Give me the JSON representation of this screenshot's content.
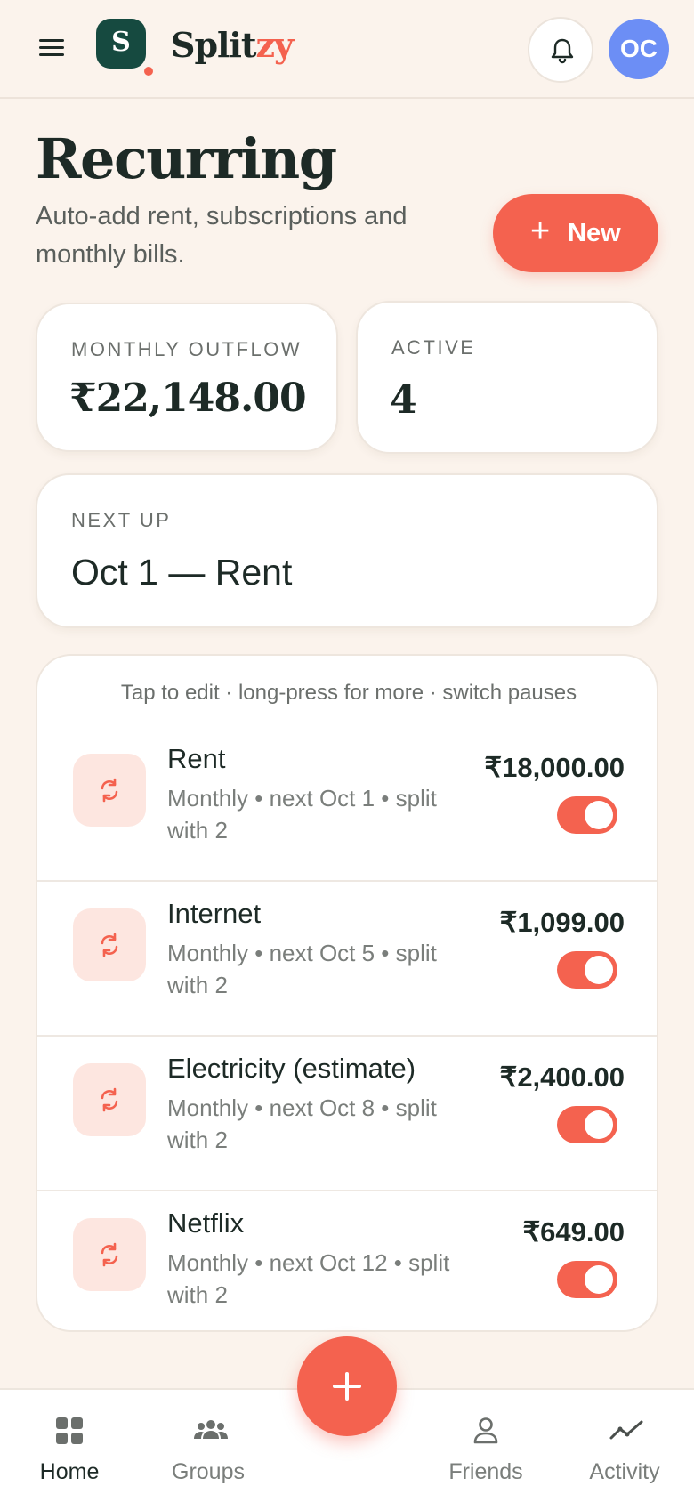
{
  "app": {
    "brand_part1": "Split",
    "brand_part2": "zy",
    "logo_letter": "S",
    "avatar_initials": "OC"
  },
  "page": {
    "title": "Recurring",
    "subtitle": "Auto-add rent, subscriptions and monthly bills.",
    "new_button_label": "New"
  },
  "stats": {
    "monthly_outflow_label": "MONTHLY OUTFLOW",
    "monthly_outflow_value": "₹22,148.00",
    "active_label": "ACTIVE",
    "active_value": "4",
    "next_up_label": "NEXT UP",
    "next_up_value": "Oct 1 — Rent"
  },
  "list": {
    "hint": "Tap to edit · long-press for more · switch pauses",
    "items": [
      {
        "title": "Rent",
        "meta": "Monthly • next Oct 1 • split with 2",
        "amount": "₹18,000.00",
        "enabled": true
      },
      {
        "title": "Internet",
        "meta": "Monthly • next Oct 5 • split with 2",
        "amount": "₹1,099.00",
        "enabled": true
      },
      {
        "title": "Electricity (estimate)",
        "meta": "Monthly • next Oct 8 • split with 2",
        "amount": "₹2,400.00",
        "enabled": true
      },
      {
        "title": "Netflix",
        "meta": "Monthly • next Oct 12 • split with 2",
        "amount": "₹649.00",
        "enabled": true
      }
    ]
  },
  "nav": {
    "home": "Home",
    "groups": "Groups",
    "friends": "Friends",
    "activity": "Activity"
  },
  "colors": {
    "accent": "#F4624F",
    "brand_dark": "#164A40",
    "avatar": "#6C8EF5",
    "background": "#FBF3EC"
  },
  "icons": {
    "menu": "hamburger-icon",
    "notifications": "bell-icon",
    "recurring": "repeat-icon",
    "home": "grid-icon",
    "groups": "people-icon",
    "friends": "person-icon",
    "activity": "trend-icon",
    "add": "plus-icon"
  }
}
